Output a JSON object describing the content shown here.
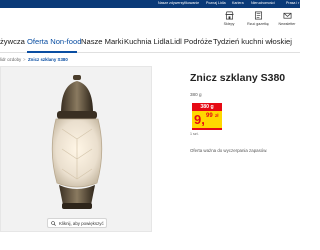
{
  "topbar": {
    "links": [
      "Nasze zdywersyfikowanie",
      "Poznaj Lidla",
      "Kariera",
      "Nieruchomości",
      "Prasa i r"
    ]
  },
  "header": {
    "icons": [
      {
        "label": "Sklepy",
        "icon": "store-icon"
      },
      {
        "label": "Rzuć gazetkę",
        "icon": "leaflet-icon"
      },
      {
        "label": "Newsletter",
        "icon": "mail-icon"
      }
    ]
  },
  "nav": {
    "items": [
      "żywcza",
      "Oferta Non-food",
      "Nasze Marki",
      "Kuchnia Lidla",
      "Lidl Podróże",
      "Tydzień kuchni włoskiej"
    ],
    "active_index": 1,
    "active_color": "#0a4ea2"
  },
  "breadcrumb": {
    "previous": "lidr ozdoby",
    "separator": ">",
    "current": "Znicz szklany S380"
  },
  "product": {
    "title": "Znicz szklany S380",
    "weight": "380 g",
    "price_tag": "380 g",
    "price_integer": "9,",
    "price_fraction": "99",
    "price_currency": "zł",
    "unit": "1 szt.",
    "stock_note": "Oferta ważna do wyczerpania zapasów.",
    "zoom_label": "Kliknij, aby powiększyć"
  },
  "colors": {
    "brand_blue": "#0a3a78",
    "price_red": "#e60a14",
    "price_yellow": "#ffd800"
  }
}
